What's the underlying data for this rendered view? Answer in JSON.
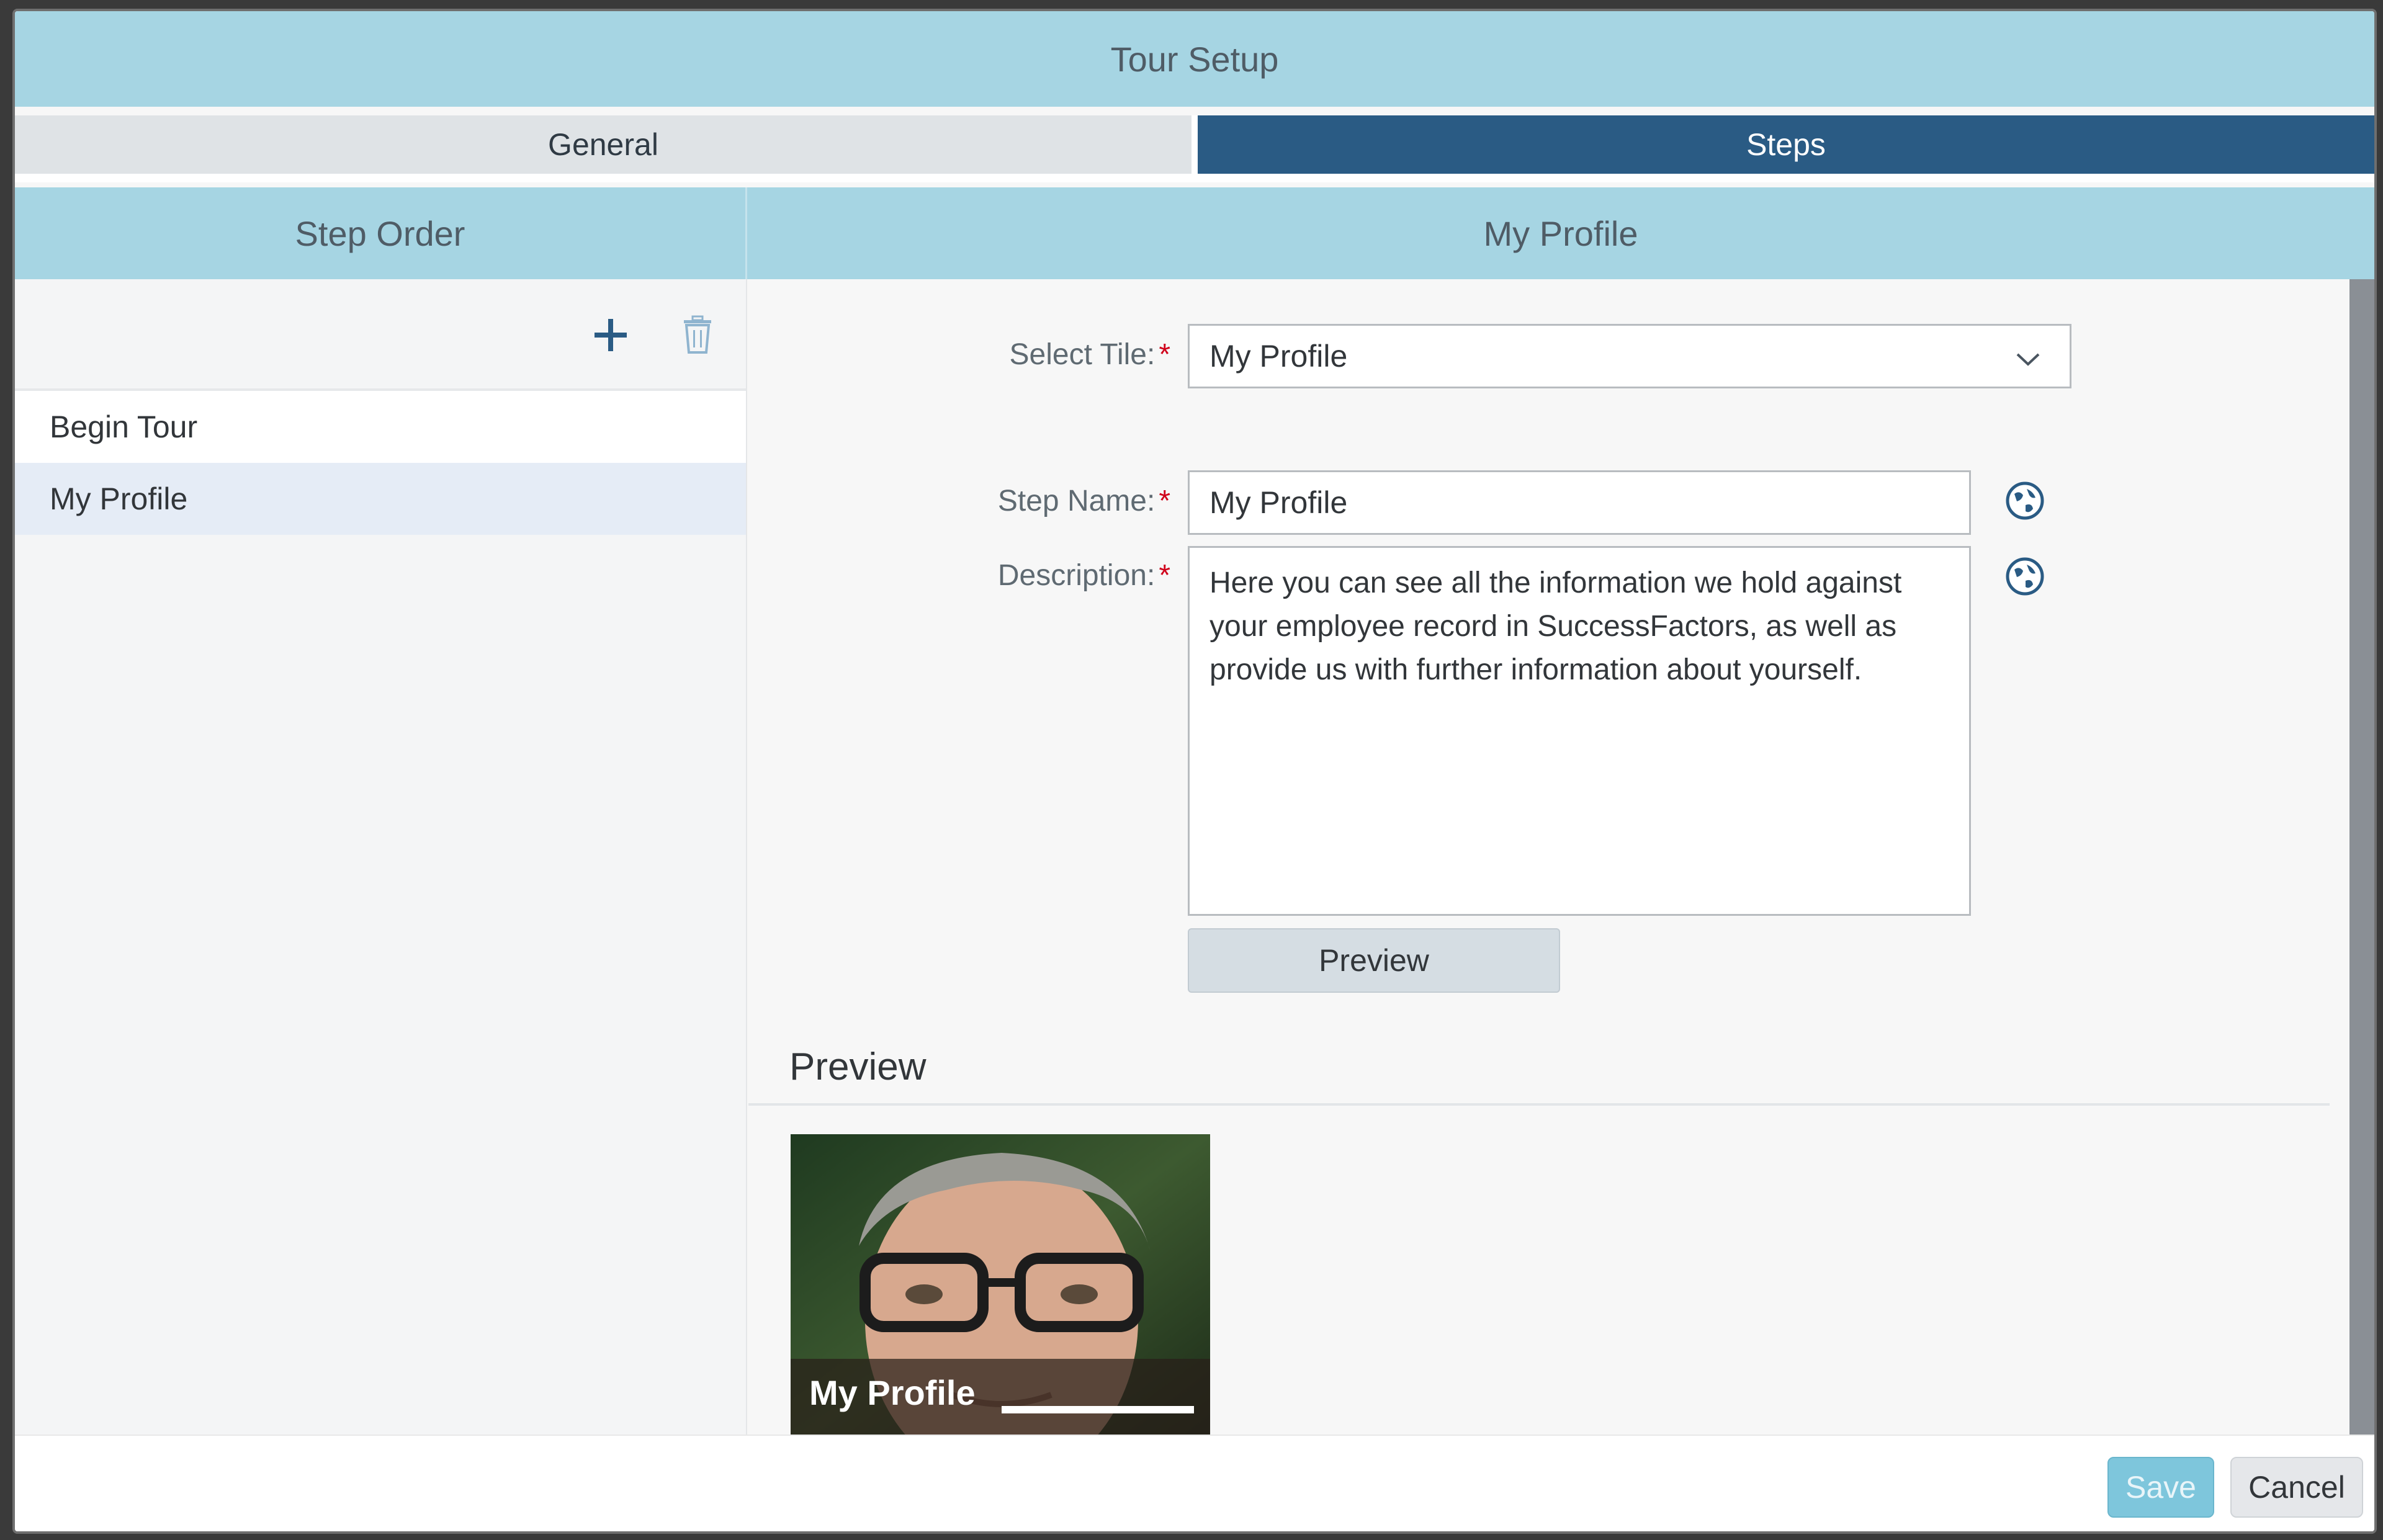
{
  "dialog": {
    "title": "Tour Setup"
  },
  "tabs": [
    {
      "label": "General",
      "active": false
    },
    {
      "label": "Steps",
      "active": true
    }
  ],
  "left": {
    "header": "Step Order",
    "add_icon": "plus-icon",
    "delete_icon": "trash-icon",
    "steps": [
      {
        "label": "Begin Tour"
      },
      {
        "label": "My Profile",
        "selected": true
      }
    ]
  },
  "right": {
    "header": "My Profile",
    "select_tile": {
      "label": "Select Tile:",
      "required_mark": "*",
      "value": "My Profile"
    },
    "step_name": {
      "label": "Step Name:",
      "required_mark": "*",
      "value": "My Profile"
    },
    "description": {
      "label": "Description:",
      "required_mark": "*",
      "value": "Here you can see all the information we hold against your employee record in SuccessFactors, as well as provide us with further information about yourself."
    },
    "translate_icon": "globe-icon",
    "preview_button": "Preview",
    "preview_heading": "Preview",
    "tile": {
      "title": "My Profile",
      "progress": 1.0
    }
  },
  "footer": {
    "save_label": "Save",
    "cancel_label": "Cancel"
  },
  "colors": {
    "header_blue": "#a6d5e3",
    "active_tab": "#2a5b84",
    "required": "#d0021b",
    "save_button": "#7ec6dc"
  }
}
